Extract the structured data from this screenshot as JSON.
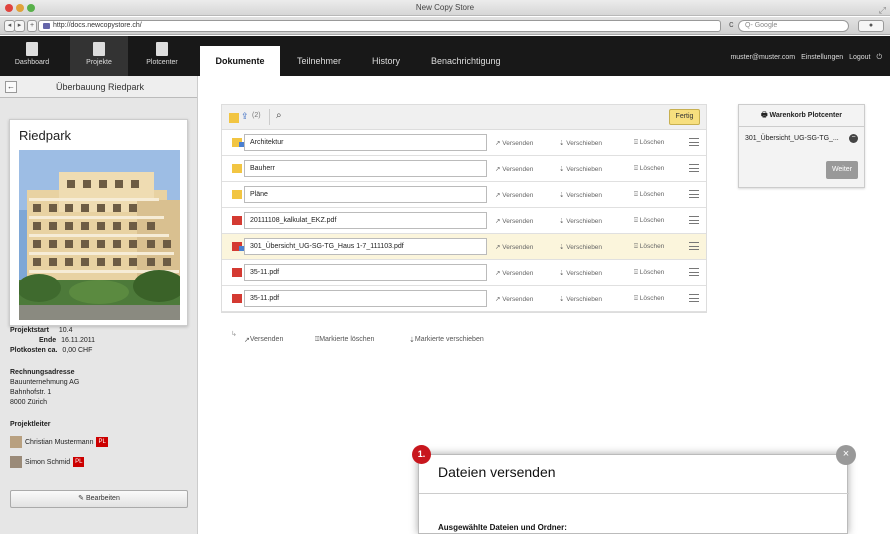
{
  "window": {
    "title": "New Copy Store"
  },
  "browser": {
    "url": "http://docs.newcopystore.ch/",
    "search_placeholder": "Q- Google",
    "plus_label": "+",
    "reload_label": "c"
  },
  "nav": {
    "tiles": [
      {
        "label": "Dashboard"
      },
      {
        "label": "Projekte"
      },
      {
        "label": "Plotcenter"
      }
    ]
  },
  "tabs": [
    {
      "label": "Dokumente"
    },
    {
      "label": "Teilnehmer"
    },
    {
      "label": "History"
    },
    {
      "label": "Benachrichtigung"
    }
  ],
  "top_links": {
    "user": "muster@muster.com",
    "settings": "Einstellungen",
    "logout": "Logout"
  },
  "sidebar": {
    "back": "←",
    "title": "Überbauung Riedpark",
    "card_title": "Riedpark",
    "projektstart_label": "Projektstart",
    "projektstart_value": "10.4",
    "ende_label": "Ende",
    "ende_value": "16.11.2011",
    "kosten_label": "Plotkosten ca.",
    "kosten_value": "0,00 CHF",
    "rechnungsadresse_label": "Rechnungsadresse",
    "rechnung_lines": [
      "Bauunternehmung AG",
      "Bahnhofstr. 1",
      "8000 Zürich"
    ],
    "projektleiter_label": "Projektleiter",
    "leiters": [
      {
        "name": "Christian Mustermann",
        "badge": "PL"
      },
      {
        "name": "Simon Schmid",
        "badge": "PL"
      }
    ],
    "edit_label": "Bearbeiten"
  },
  "list": {
    "toolbar_count": "(2)",
    "fertig": "Fertig",
    "actions": {
      "send": "Versenden",
      "move": "Verschieben",
      "delete": "Löschen"
    },
    "rows": [
      {
        "name": "Architektur",
        "type": "folder",
        "selected": true
      },
      {
        "name": "Bauherr",
        "type": "folder",
        "selected": false
      },
      {
        "name": "Pläne",
        "type": "folder",
        "selected": false
      },
      {
        "name": "20111108_kalkulat_EKZ.pdf",
        "type": "pdf",
        "selected": false
      },
      {
        "name": "301_Übersicht_UG-SG-TG_Haus 1-7_111103.pdf",
        "type": "pdf",
        "selected": true
      },
      {
        "name": "35-11.pdf",
        "type": "pdf",
        "selected": false
      },
      {
        "name": "35-11.pdf",
        "type": "pdf",
        "selected": false
      }
    ],
    "bulk": {
      "send": "Versenden",
      "delete": "Markierte löschen",
      "move": "Markierte verschieben"
    }
  },
  "cart": {
    "title": "Warenkorb Plotcenter",
    "item": "301_Übersicht_UG-SG-TG_...",
    "remove": "−",
    "weiter": "Weiter"
  },
  "dialog": {
    "step": "1.",
    "title": "Dateien versenden",
    "subtitle": "Ausgewählte Dateien und Ordner:",
    "close": "×"
  }
}
